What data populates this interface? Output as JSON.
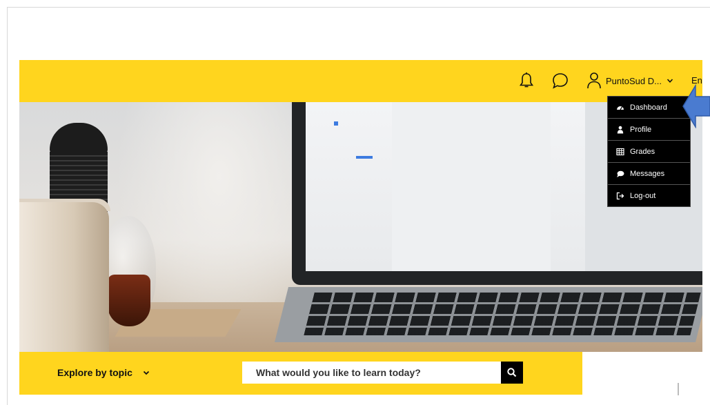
{
  "colors": {
    "accent": "#FFD51E",
    "menu_bg": "#000000",
    "callout": "#4A7BD0"
  },
  "header": {
    "icons": [
      "bell-icon",
      "chat-bubble-icon",
      "user-icon",
      "chevron-down-icon"
    ],
    "user_name": "PuntoSud D...",
    "language": "En"
  },
  "user_menu": {
    "items": [
      {
        "label": "Dashboard",
        "icon": "dashboard-icon"
      },
      {
        "label": "Profile",
        "icon": "person-icon"
      },
      {
        "label": "Grades",
        "icon": "table-icon"
      },
      {
        "label": "Messages",
        "icon": "speech-bubble-icon"
      },
      {
        "label": "Log-out",
        "icon": "sign-out-icon"
      }
    ]
  },
  "hero": {
    "image": "desk-with-mug-bulb-and-laptop"
  },
  "search_bar": {
    "explore_label": "Explore by topic",
    "placeholder": "What would you like to learn today?",
    "search_icon": "search-icon"
  }
}
